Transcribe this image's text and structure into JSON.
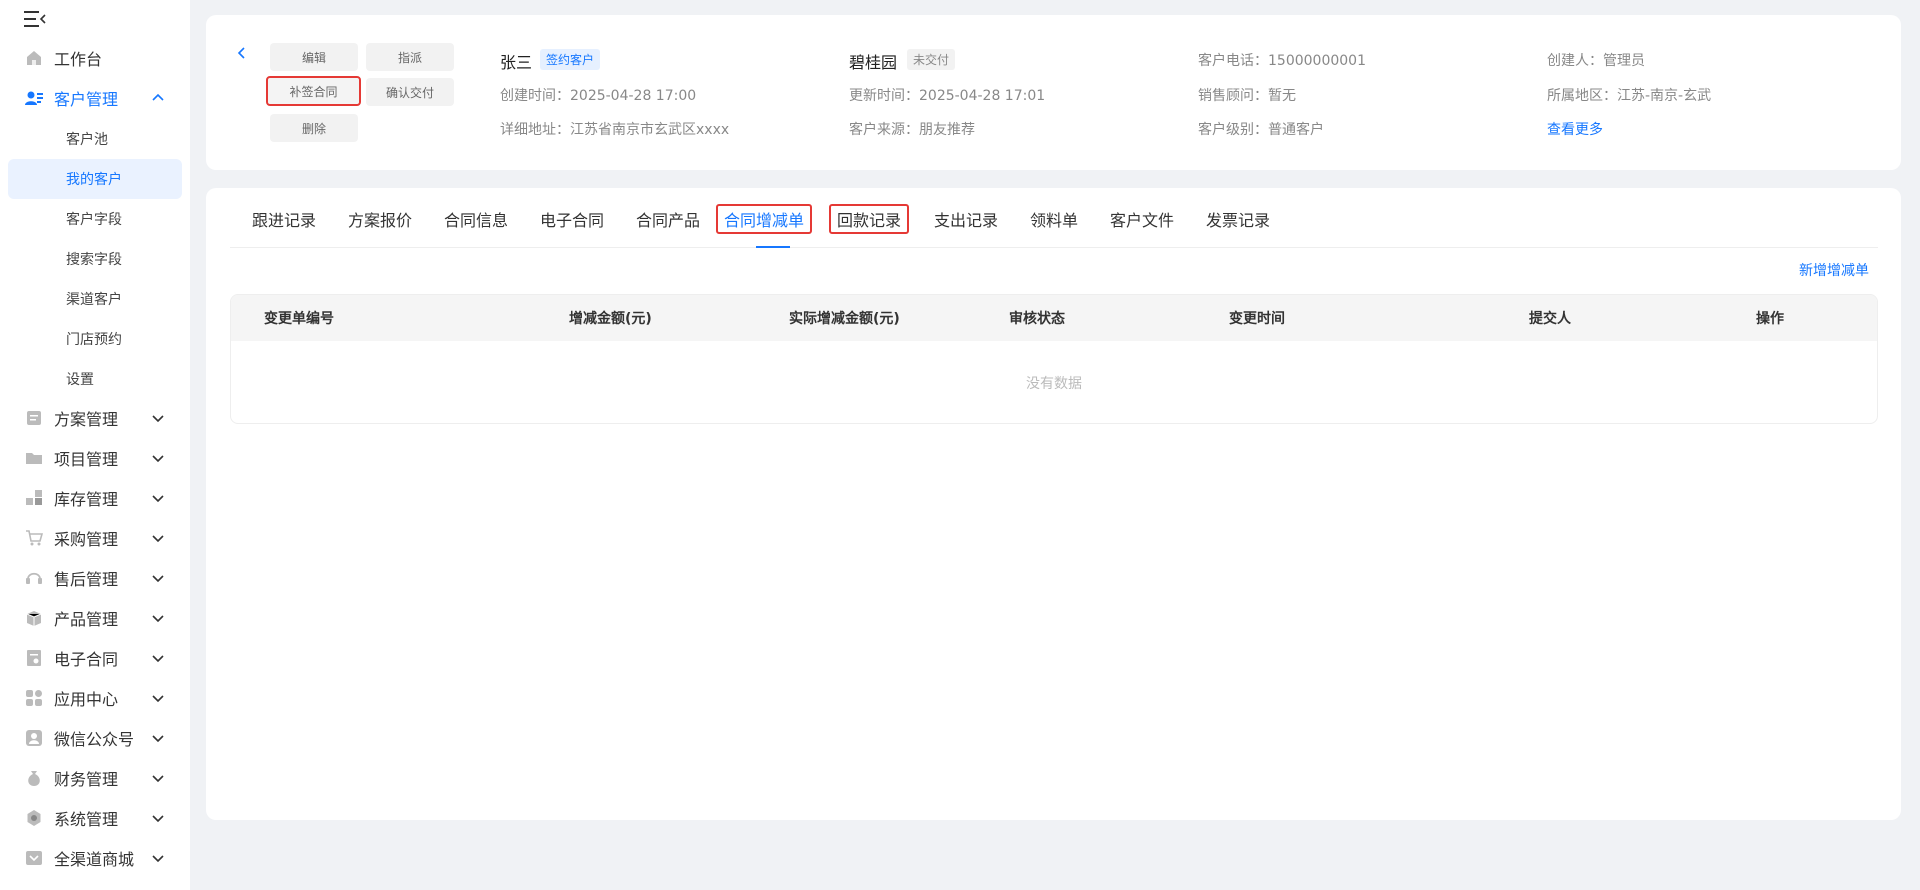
{
  "sidebar": {
    "items": [
      {
        "label": "工作台",
        "icon": "home-icon"
      },
      {
        "label": "客户管理",
        "icon": "customer-icon",
        "expanded": true
      },
      {
        "label": "方案管理",
        "icon": "plan-icon"
      },
      {
        "label": "项目管理",
        "icon": "folder-icon"
      },
      {
        "label": "库存管理",
        "icon": "inventory-icon"
      },
      {
        "label": "采购管理",
        "icon": "cart-icon"
      },
      {
        "label": "售后管理",
        "icon": "headset-icon"
      },
      {
        "label": "产品管理",
        "icon": "box-icon"
      },
      {
        "label": "电子合同",
        "icon": "contract-icon"
      },
      {
        "label": "应用中心",
        "icon": "apps-icon"
      },
      {
        "label": "微信公众号",
        "icon": "wechat-icon"
      },
      {
        "label": "财务管理",
        "icon": "money-bag-icon"
      },
      {
        "label": "系统管理",
        "icon": "settings-icon"
      },
      {
        "label": "全渠道商城",
        "icon": "mall-icon"
      }
    ],
    "sub_items": [
      "客户池",
      "我的客户",
      "客户字段",
      "搜索字段",
      "渠道客户",
      "门店预约",
      "设置"
    ],
    "selected_sub": "我的客户"
  },
  "header": {
    "buttons": {
      "edit": "编辑",
      "assign": "指派",
      "supplement_contract": "补签合同",
      "confirm_delivery": "确认交付",
      "delete": "删除"
    },
    "customer_name": "张三",
    "customer_tag": "签约客户",
    "created_label": "创建时间：",
    "created_value": "2025-04-28 17:00",
    "address_label": "详细地址：",
    "address_value": "江苏省南京市玄武区xxxx",
    "project_name": "碧桂园",
    "project_tag": "未交付",
    "updated_label": "更新时间：",
    "updated_value": "2025-04-28 17:01",
    "source_label": "客户来源：",
    "source_value": "朋友推荐",
    "phone_label": "客户电话：",
    "phone_value": "15000000001",
    "consultant_label": "销售顾问：",
    "consultant_value": "暂无",
    "level_label": "客户级别：",
    "level_value": "普通客户",
    "creator_label": "创建人：",
    "creator_value": "管理员",
    "region_label": "所属地区：",
    "region_value": "江苏-南京-玄武",
    "more_link": "查看更多"
  },
  "tabs": [
    "跟进记录",
    "方案报价",
    "合同信息",
    "电子合同",
    "合同产品",
    "合同增减单",
    "回款记录",
    "支出记录",
    "领料单",
    "客户文件",
    "发票记录"
  ],
  "active_tab": "合同增减单",
  "add_link": "新增增减单",
  "table": {
    "columns": [
      "变更单编号",
      "增减金额(元)",
      "实际增减金额(元)",
      "审核状态",
      "变更时间",
      "提交人",
      "操作"
    ],
    "empty_text": "没有数据"
  },
  "colors": {
    "accent": "#1677ff",
    "highlight": "#e53935"
  }
}
